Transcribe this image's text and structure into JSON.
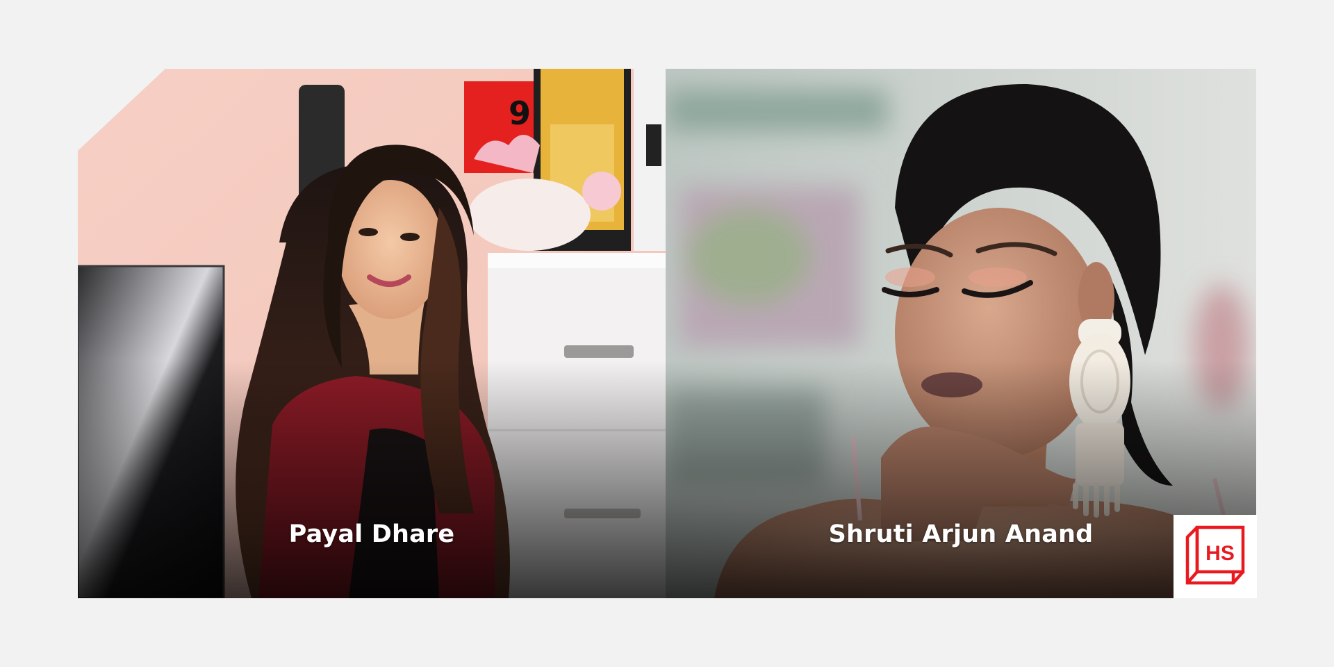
{
  "people": [
    {
      "name": "Payal Dhare"
    },
    {
      "name": "Shruti Arjun Anand"
    }
  ],
  "logo": {
    "text": "HS",
    "color": "#e8191f"
  },
  "background_color": "#f2f2f2"
}
